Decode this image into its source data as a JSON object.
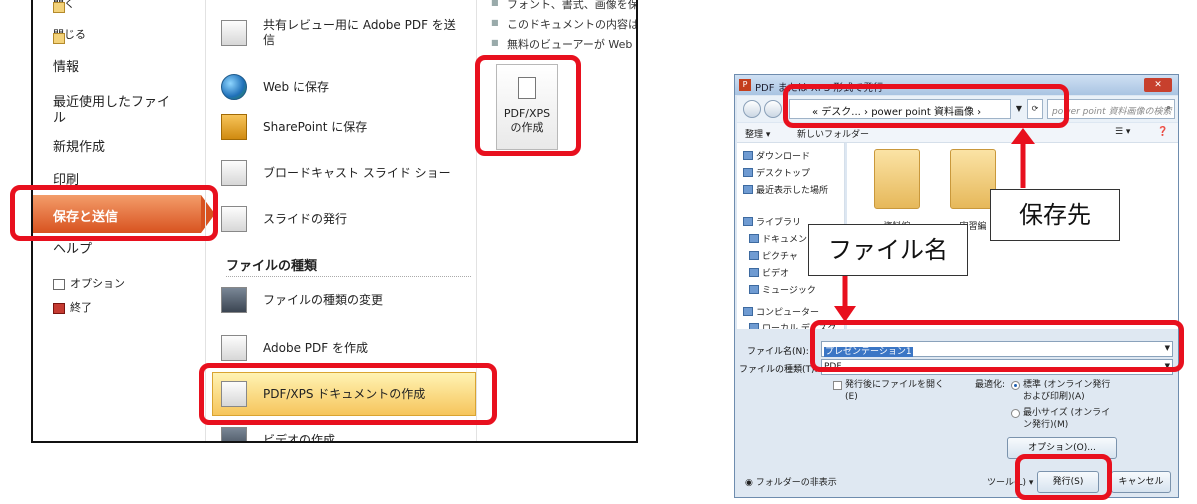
{
  "backstage": {
    "nav": {
      "open": "開く",
      "close": "閉じる",
      "info": "情報",
      "recent": "最近使用したファイ\nル",
      "new": "新規作成",
      "print": "印刷",
      "save_send": "保存と送信",
      "help": "ヘルプ",
      "options": "オプション",
      "exit": "終了"
    },
    "options": [
      {
        "label": "共有レビュー用に Adobe PDF を送\n信"
      },
      {
        "label": "Web に保存"
      },
      {
        "label": "SharePoint に保存"
      },
      {
        "label": "ブロードキャスト スライド ショー"
      },
      {
        "label": "スライドの発行"
      }
    ],
    "file_types_heading": "ファイルの種類",
    "file_types": [
      {
        "label": "ファイルの種類の変更"
      },
      {
        "label": "Adobe PDF を作成"
      },
      {
        "label": "PDF/XPS ドキュメントの作成"
      },
      {
        "label": "ビデオの作成"
      }
    ],
    "right": {
      "bullets": [
        "フォント、書式、画像を保",
        "このドキュメントの内容は",
        "無料のビューアーが Web"
      ],
      "create_button": "PDF/XPS\nの作成"
    }
  },
  "dialog": {
    "title": "PDF または XPS 形式で発行",
    "address_parts": "« デスク... › power point 資料画像 ›",
    "search_placeholder": "power point 資料画像の検索",
    "toolbar": {
      "organize": "整理 ▾",
      "new_folder": "新しいフォルダー"
    },
    "tree": [
      "ダウンロード",
      "デスクトップ",
      "最近表示した場所",
      "ライブラリ",
      "ドキュメント",
      "ピクチャ",
      "ビデオ",
      "ミュージック",
      "コンピューター",
      "ローカル ディスク"
    ],
    "folders": [
      {
        "label": "資料編"
      },
      {
        "label": "実習編"
      }
    ],
    "filename_label": "ファイル名(N):",
    "filename_value": "プレゼンテーション1",
    "filetype_label": "ファイルの種類(T):",
    "filetype_value": "PDF",
    "open_after": "発行後にファイルを開く\n(E)",
    "optimize_label": "最適化:",
    "opt_standard": "標準 (オンライン発行\nおよび印刷)(A)",
    "opt_minimum": "最小サイズ (オンライ\nン発行)(M)",
    "options_button": "オプション(O)...",
    "hide_folders": "フォルダーの非表示",
    "tools": "ツール(L)",
    "publish": "発行(S)",
    "cancel": "キャンセル"
  },
  "callouts": {
    "save_location": "保存先",
    "file_name": "ファイル名"
  },
  "colors": {
    "highlight": "#e8101e",
    "nav_active": "#d8521f"
  }
}
